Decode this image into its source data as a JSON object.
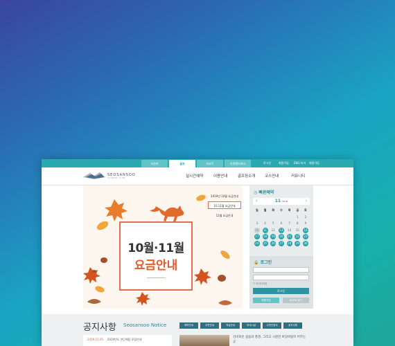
{
  "topbar": {
    "tabs": [
      "서산바",
      "골프",
      "리조트",
      "아일랜드파크"
    ],
    "utils": [
      "로그인",
      "회원가입",
      "ENG 보기",
      "회원가입"
    ]
  },
  "header": {
    "logo_text": "SEOSANSOO",
    "logo_sub": "COUNTRY CLUB",
    "menu": [
      "실시간예약",
      "이용안내",
      "골프장소개",
      "코스안내",
      "커뮤니티"
    ]
  },
  "visual": {
    "title_line1": "10월·11월",
    "title_line2": "요금안내",
    "months": [
      "2019년 10월 요금안내",
      "10,11월 요금안내",
      "12월 요금안내"
    ]
  },
  "reserve": {
    "title": "빠른예약",
    "month": "11",
    "month_sub": "MON",
    "weekdays": [
      "일",
      "월",
      "화",
      "수",
      "목",
      "금",
      "토"
    ],
    "weeks": [
      [
        "",
        "",
        "",
        "",
        "",
        "1",
        "2"
      ],
      [
        "3",
        "4",
        "5",
        "6",
        "7",
        "8",
        "9"
      ],
      [
        "10",
        "11",
        "12",
        "13",
        "14",
        "15",
        "16"
      ],
      [
        "17",
        "18",
        "19",
        "20",
        "21",
        "22",
        "23"
      ],
      [
        "24",
        "25",
        "26",
        "27",
        "28",
        "29",
        "30"
      ]
    ],
    "states": [
      [
        "",
        "",
        "",
        "",
        "",
        "n",
        "n"
      ],
      [
        "n",
        "n",
        "n",
        "n",
        "n",
        "n",
        "n"
      ],
      [
        "g",
        "a",
        "n",
        "a",
        "n",
        "n",
        "a"
      ],
      [
        "a",
        "a",
        "a",
        "a",
        "a",
        "a",
        "a"
      ],
      [
        "a",
        "a",
        "a",
        "a",
        "a",
        "a",
        "a"
      ]
    ]
  },
  "login": {
    "title": "로그인",
    "save_id": "아이디저장",
    "button": "로그인",
    "join": "회원가입",
    "find": "ID/PW 찾기"
  },
  "notice": {
    "title": "공지사항",
    "title_en": "Seosansoo Notice",
    "tabs": [
      "예약안내",
      "주변안내",
      "객실안내",
      "부대시설",
      "주변관광지",
      "공지사항"
    ],
    "item_date": "2019.11.05",
    "item_text": "2019년도 연단체팀 모집안내",
    "feature_text": "신비로운 섬들의 풍경, 그리고 시원한 바닷바람이 머무는 곳"
  },
  "colors": {
    "teal": "#2aaab0",
    "accent_orange": "#e65a2a",
    "calendar_available": "#28a3aa"
  }
}
